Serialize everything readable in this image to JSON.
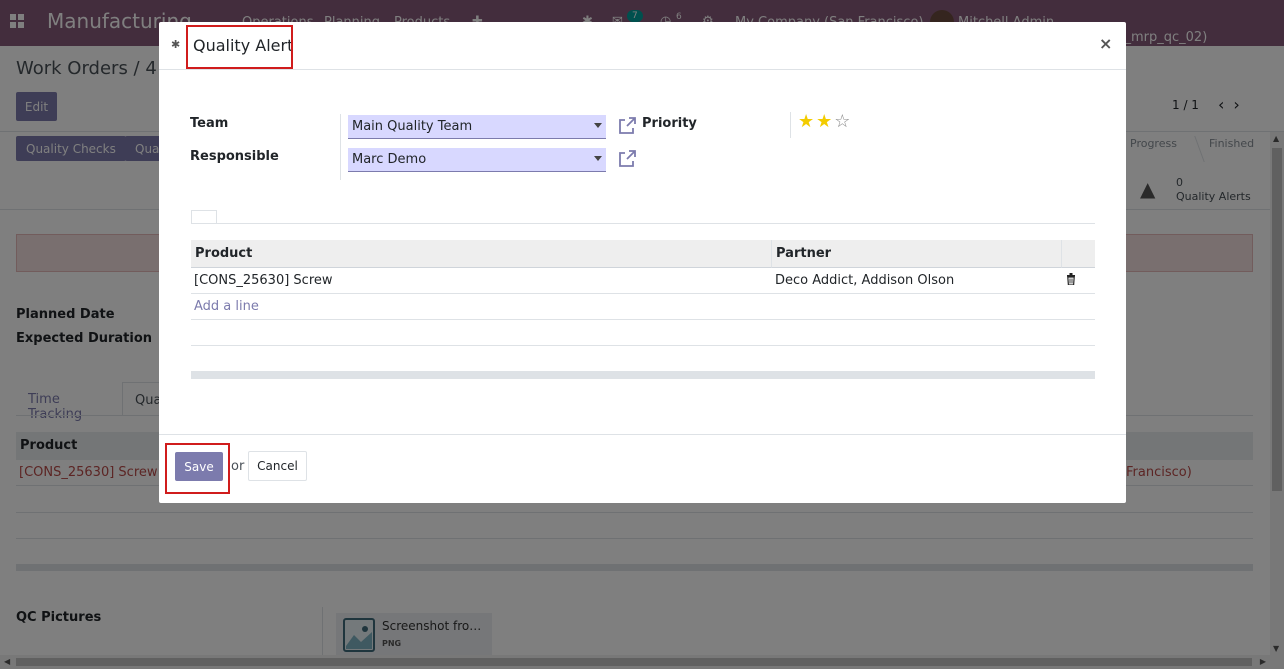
{
  "app": {
    "title": "Manufacturing",
    "menu": [
      "Operations",
      "Planning",
      "Products"
    ],
    "company": "My Company (San Francisco)",
    "user": "Mitchell Admin (v14_21_11_eh_inventory_mrp_qc_02)",
    "chat_count": "7",
    "activity_count": "6"
  },
  "page": {
    "breadcrumb": "Work Orders / 4 -",
    "edit_label": "Edit",
    "pager": "1 / 1",
    "buttons": [
      "Quality Checks",
      "Qua"
    ],
    "stages": [
      "Progress",
      "Finished"
    ],
    "quality_alerts_count": "0",
    "quality_alerts_label": "Quality Alerts",
    "planned_date_label": "Planned Date",
    "expected_duration_label": "Expected Duration",
    "tabs": [
      "Time Tracking",
      "Qua"
    ],
    "table_header": "Product",
    "row_product": "[CONS_25630] Screw",
    "row_suffix": "Francisco)",
    "qc_pictures_label": "QC Pictures",
    "attachment_name": "Screenshot fro…",
    "attachment_ext": "PNG"
  },
  "dialog": {
    "title": "Quality Alert",
    "close": "×",
    "team_label": "Team",
    "team_value": "Main Quality Team",
    "responsible_label": "Responsible",
    "responsible_value": "Marc Demo",
    "priority_label": "Priority",
    "priority_stars": 2,
    "priority_max": 3,
    "lines_table": {
      "columns": [
        "Product",
        "Partner"
      ],
      "rows": [
        {
          "product": "[CONS_25630] Screw",
          "partner": "Deco Addict, Addison Olson"
        }
      ],
      "add_line_label": "Add a line"
    },
    "save_label": "Save",
    "or_label": "or",
    "cancel_label": "Cancel"
  },
  "colors": {
    "brand": "#875a7b",
    "primary_button": "#7c7bad",
    "highlight": "#d01c1c",
    "star": "#f3cc00"
  }
}
